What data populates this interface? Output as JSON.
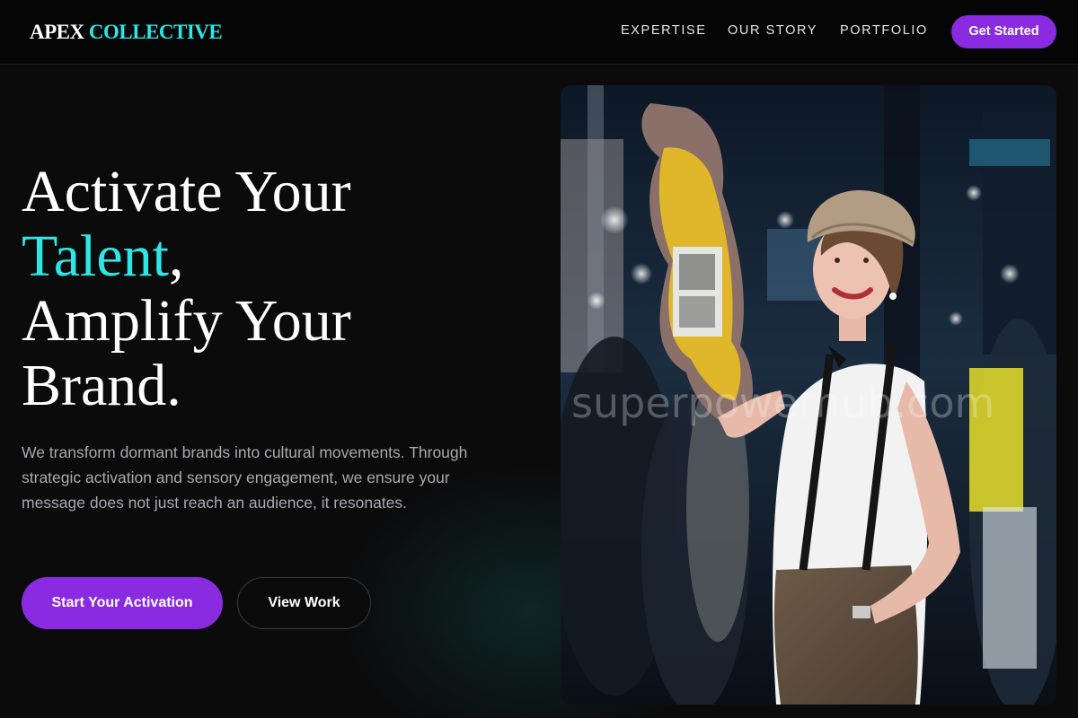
{
  "brand": {
    "part1": "APEX",
    "part2": "COLLECTIVE"
  },
  "nav": {
    "links": [
      "EXPERTISE",
      "OUR STORY",
      "PORTFOLIO"
    ],
    "cta": "Get Started"
  },
  "hero": {
    "line1": "Activate Your",
    "accent": "Talent",
    "accent_suffix": ",",
    "line3": "Amplify Your",
    "line4": "Brand.",
    "description": "We transform dormant brands into cultural movements. Through strategic activation and sensory engagement, we ensure your message does not just reach an audience, it resonates.",
    "primary_cta": "Start Your Activation",
    "secondary_cta": "View Work"
  },
  "image": {
    "watermark": "superpowerhub.com"
  },
  "colors": {
    "accent": "#2ee6e6",
    "brand_purple": "#8a2be2",
    "background": "#0b0b0c"
  }
}
